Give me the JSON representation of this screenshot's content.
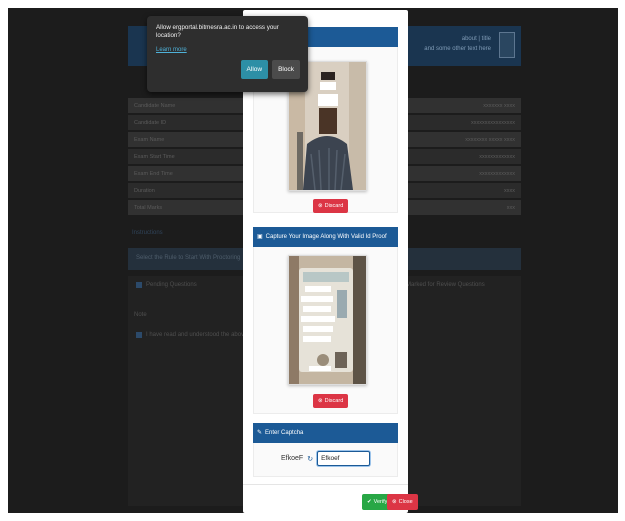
{
  "background": {
    "header_info": [
      "about | title",
      "and some other text here"
    ],
    "rows": [
      {
        "label": "Candidate Name",
        "value": "xxxxxxx xxxx"
      },
      {
        "label": "Candidate ID",
        "value": "xxxxxxxxxxxxxxxx"
      },
      {
        "label": "Exam Name",
        "value": "xxxxxxxx xxxxx xxxx"
      },
      {
        "label": "Exam Start Time",
        "value": "xxxxxxxxxxxxx"
      },
      {
        "label": "Exam End Time",
        "value": "xxxxxxxxxxxxx"
      },
      {
        "label": "Duration",
        "value": "xxxx"
      },
      {
        "label": "Total Marks",
        "value": "xxx"
      }
    ],
    "section_title": "Instructions",
    "bar_text": "Select the Rule to Start With Proctoring",
    "pending_label": "Pending Questions",
    "review_label": "Marked for Review Questions",
    "note_label": "Note",
    "note_text": "I have read and understood the above instructions"
  },
  "permission": {
    "message": "Allow ergportal.bitmesra.ac.in to access your location?",
    "learn_more": "Learn more",
    "allow": "Allow",
    "block": "Block"
  },
  "modal": {
    "discard_label": "Discard",
    "id_proof_title": "Capture Your Image Along With Valid Id Proof",
    "captcha_title": "Enter Captcha",
    "captcha_code": "EfkoeF",
    "captcha_value": "Efkoef",
    "verify_label": "Verify",
    "close_label": "Close"
  },
  "colors": {
    "primary": "#1c5a96",
    "danger": "#dc3545",
    "success": "#28a745",
    "allow": "#2d8fa6"
  }
}
